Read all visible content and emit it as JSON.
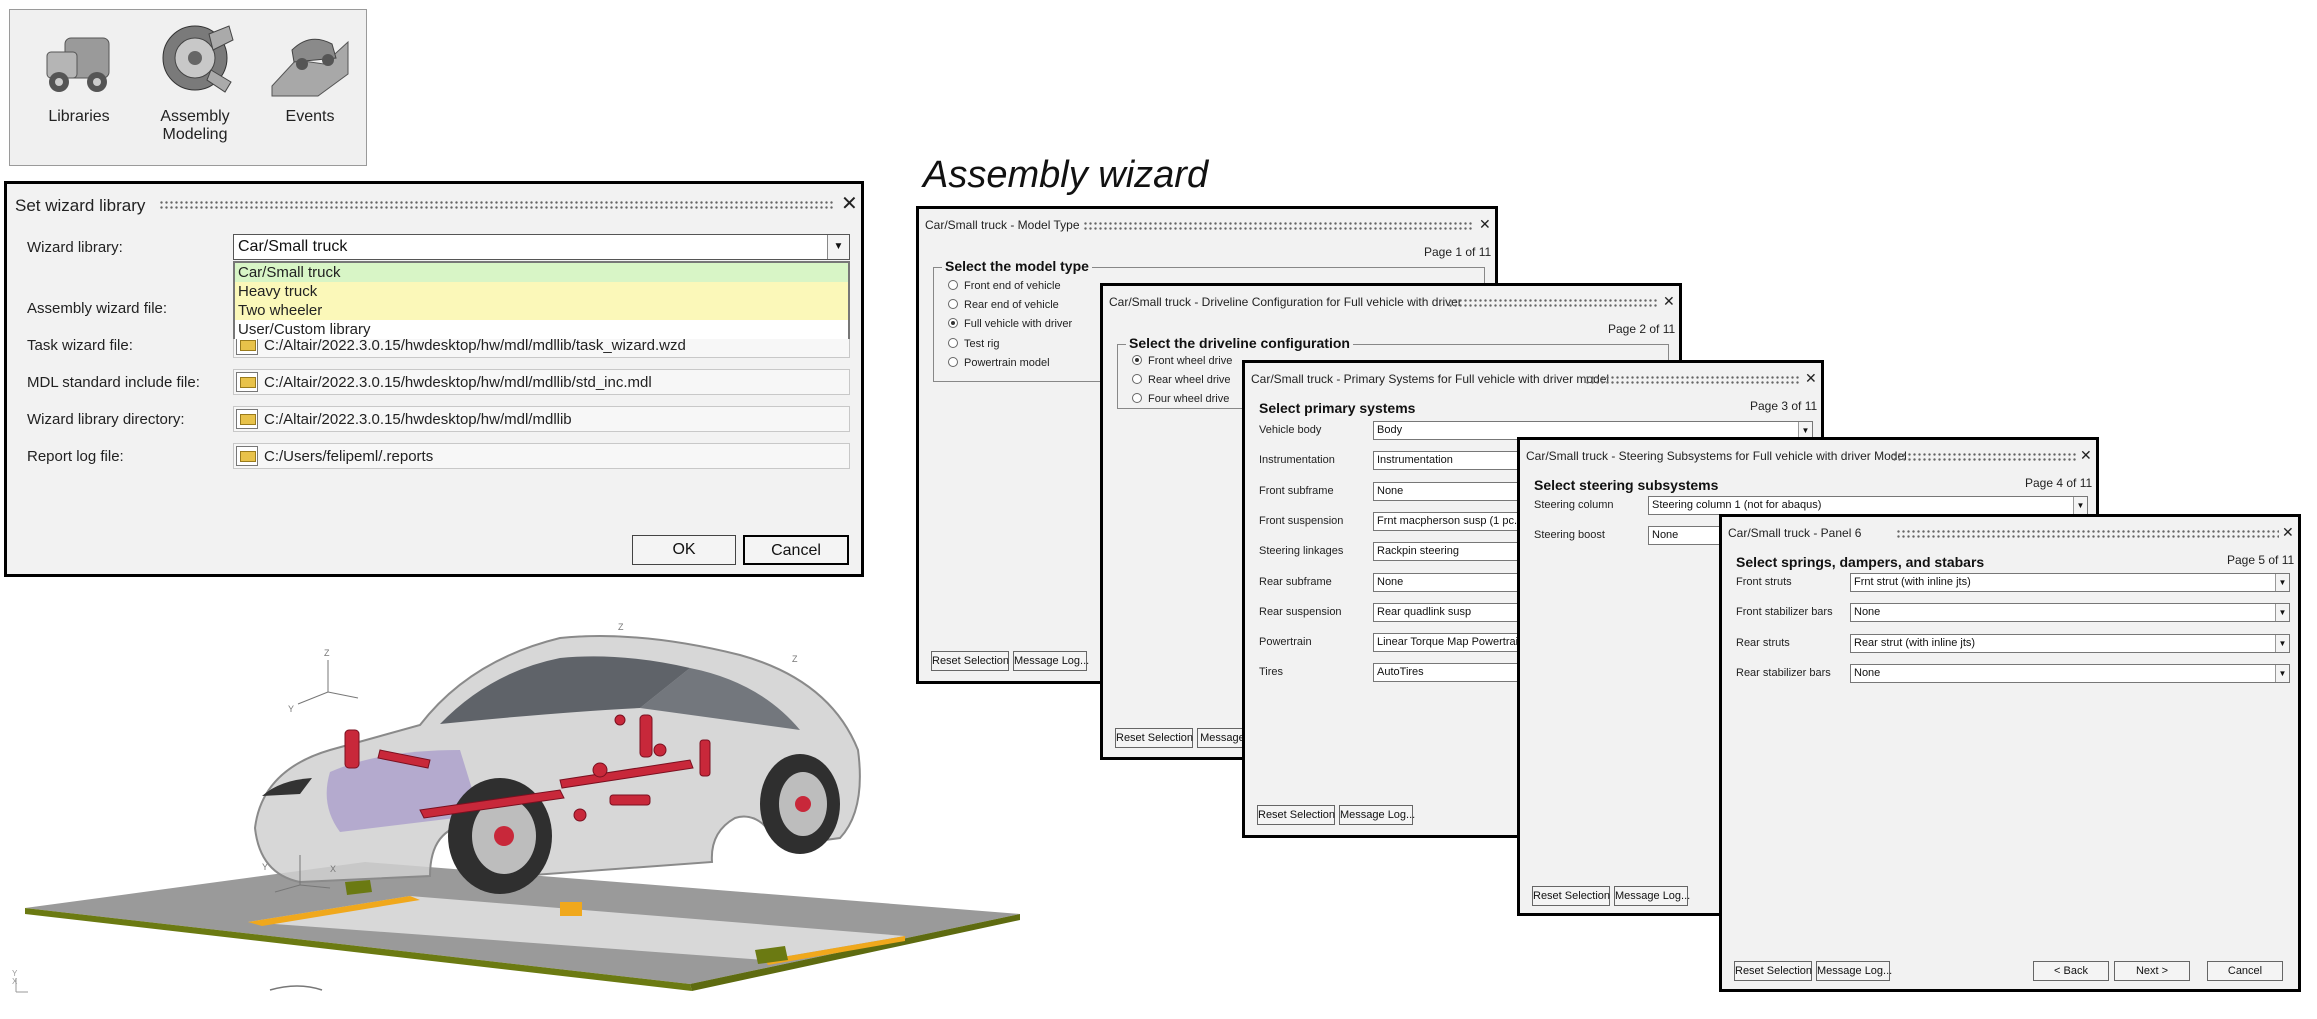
{
  "ribbon": {
    "libraries": "Libraries",
    "assembly_line1": "Assembly",
    "assembly_line2": "Modeling",
    "events": "Events"
  },
  "library_dialog": {
    "title": "Set wizard library",
    "wizard_library_label": "Wizard library:",
    "wizard_library_value": "Car/Small truck",
    "options": [
      "Car/Small truck",
      "Heavy truck",
      "Two wheeler",
      "User/Custom library"
    ],
    "assembly_wizard_file_label": "Assembly wizard file:",
    "task_wizard_file_label": "Task wizard file:",
    "task_wizard_file_value": "C:/Altair/2022.3.0.15/hwdesktop/hw/mdl/mdllib/task_wizard.wzd",
    "mdl_include_label": "MDL standard include file:",
    "mdl_include_value": "C:/Altair/2022.3.0.15/hwdesktop/hw/mdl/mdllib/std_inc.mdl",
    "library_dir_label": "Wizard library directory:",
    "library_dir_value": "C:/Altair/2022.3.0.15/hwdesktop/hw/mdl/mdllib",
    "report_log_label": "Report log file:",
    "report_log_value": "C:/Users/felipeml/.reports",
    "ok": "OK",
    "cancel": "Cancel"
  },
  "heading": "Assembly wizard",
  "common": {
    "reset": "Reset Selection",
    "message_log": "Message Log...",
    "message_log_cut": "Message L",
    "back": "< Back",
    "next": "Next >",
    "cancel": "Cancel"
  },
  "page1": {
    "title": "Car/Small truck - Model Type",
    "page": "Page  1 of 11",
    "group": "Select the model type",
    "options": [
      "Front end of vehicle",
      "Rear end of vehicle",
      "Full vehicle with driver",
      "Test rig",
      "Powertrain model"
    ],
    "selected_index": 2
  },
  "page2": {
    "title": "Car/Small truck - Driveline Configuration for Full vehicle with driver",
    "page": "Page  2 of 11",
    "group": "Select the driveline configuration",
    "options": [
      "Front wheel drive",
      "Rear wheel drive",
      "Four wheel drive"
    ],
    "selected_index": 0
  },
  "page3": {
    "title": "Car/Small truck - Primary Systems for Full vehicle with driver model",
    "page": "Page  3 of 11",
    "header": "Select primary systems",
    "rows": [
      {
        "label": "Vehicle body",
        "value": "Body"
      },
      {
        "label": "Instrumentation",
        "value": "Instrumentation"
      },
      {
        "label": "Front subframe",
        "value": "None"
      },
      {
        "label": "Front suspension",
        "value": "Frnt macpherson susp (1 pc. LCA)"
      },
      {
        "label": "Steering linkages",
        "value": "Rackpin steering"
      },
      {
        "label": "Rear subframe",
        "value": "None"
      },
      {
        "label": "Rear suspension",
        "value": "Rear quadlink susp"
      },
      {
        "label": "Powertrain",
        "value": "Linear Torque Map Powertrain"
      },
      {
        "label": "Tires",
        "value": "AutoTires"
      }
    ]
  },
  "page4": {
    "title": "Car/Small truck - Steering Subsystems for Full vehicle with driver Model",
    "page": "Page  4 of 11",
    "header": "Select steering subsystems",
    "rows": [
      {
        "label": "Steering column",
        "value": "Steering column 1  (not for abaqus)"
      },
      {
        "label": "Steering boost",
        "value": "None"
      }
    ]
  },
  "page5": {
    "title": "Car/Small truck - Panel 6",
    "page": "Page  5 of 11",
    "header": "Select springs, dampers, and stabars",
    "rows": [
      {
        "label": "Front struts",
        "value": "Frnt strut (with inline jts)"
      },
      {
        "label": "Front stabilizer bars",
        "value": "None"
      },
      {
        "label": "Rear struts",
        "value": "Rear strut (with inline jts)"
      },
      {
        "label": "Rear stabilizer bars",
        "value": "None"
      }
    ]
  },
  "scene": {
    "axis_z": "Z",
    "axis_y": "Y",
    "axis_x": "X"
  },
  "colors": {
    "dropdown_bg": "#fbf8b9",
    "dropdown_selected": "#d8f5c6",
    "road_orange": "#f0a81c",
    "ground_green": "#6b7a12",
    "ground_gray": "#9a9a9a"
  }
}
